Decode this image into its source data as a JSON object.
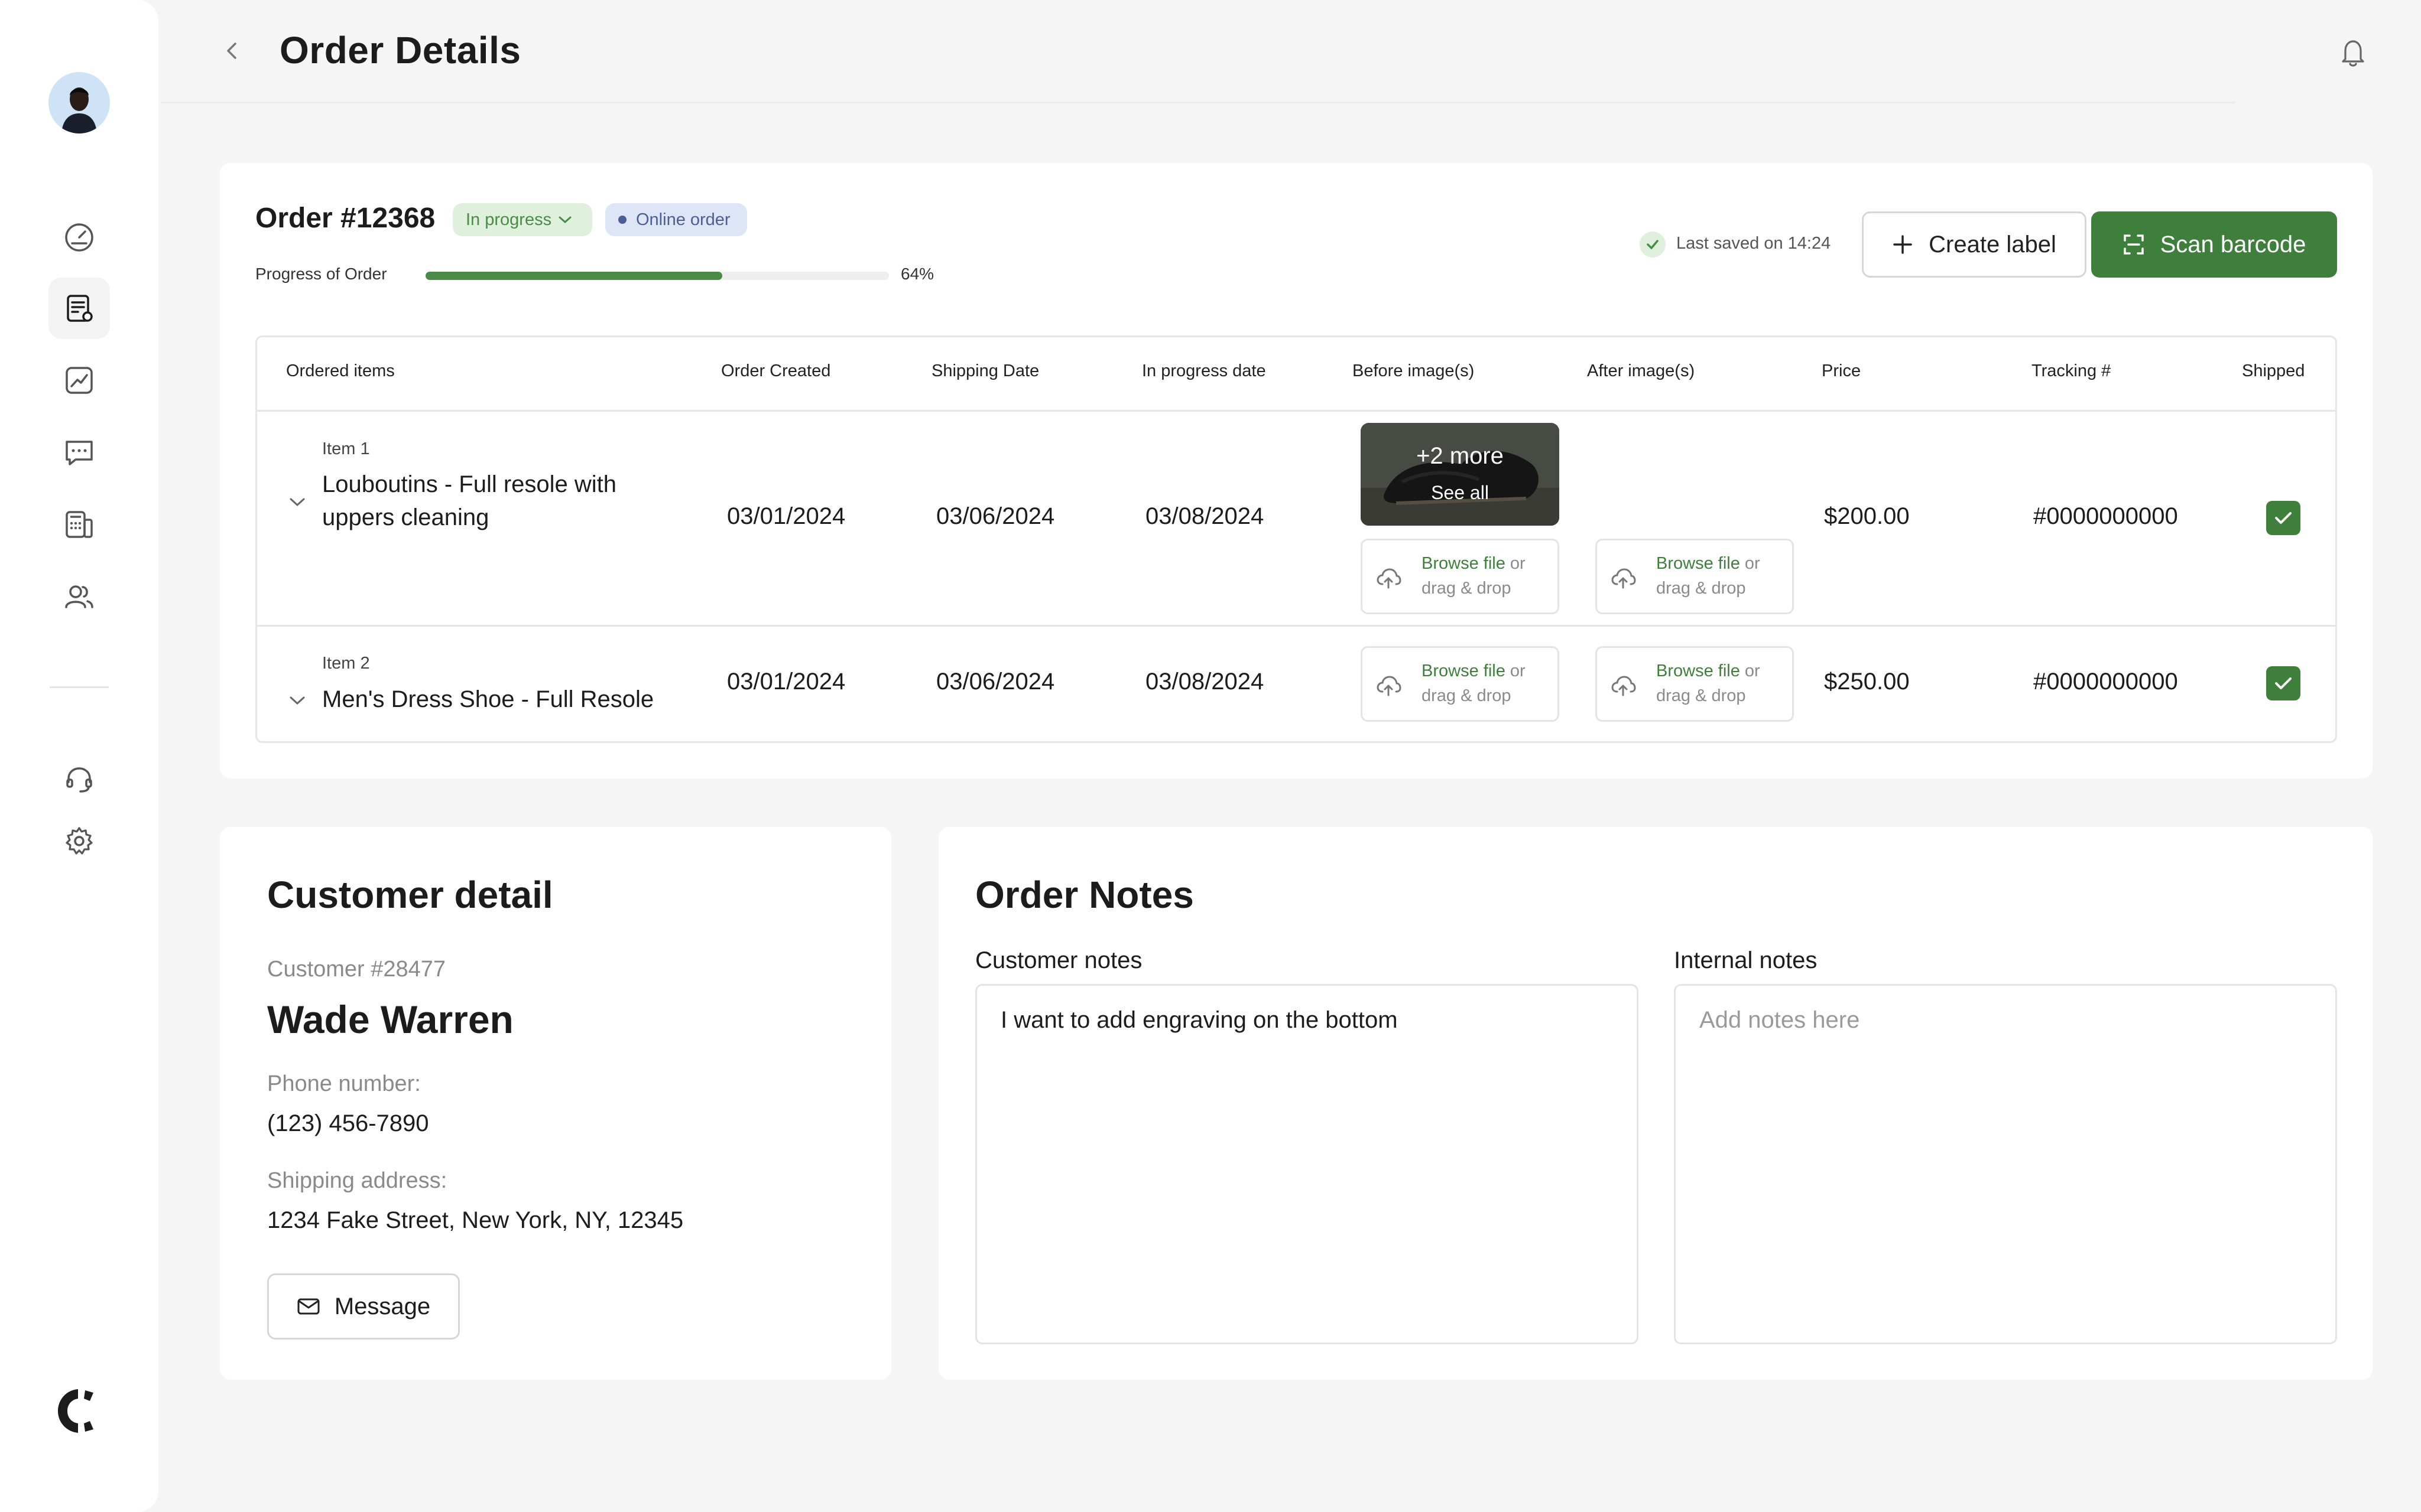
{
  "header": {
    "title": "Order Details"
  },
  "order": {
    "number": "Order #12368",
    "status": "In progress",
    "type": "Online order",
    "progress_label": "Progress of Order",
    "progress_value": 0.64,
    "progress_text": "64%",
    "last_saved": "Last saved on 14:24",
    "create_label": "Create label",
    "scan_barcode": "Scan barcode"
  },
  "table": {
    "columns": [
      "Ordered items",
      "Order Created",
      "Shipping Date",
      "In progress date",
      "Before image(s)",
      "After image(s)",
      "Price",
      "Tracking #",
      "Shipped"
    ],
    "upload_link": "Browse file",
    "upload_or": " or",
    "upload_drag": "drag & drop",
    "more_images": "+2 more",
    "see_all": "See all",
    "rows": [
      {
        "item_no": "Item 1",
        "name_line1": "Louboutins - Full resole with",
        "name_line2": "uppers cleaning",
        "created": "03/01/2024",
        "shipping": "03/06/2024",
        "in_progress": "03/08/2024",
        "price": "$200.00",
        "tracking": "#0000000000",
        "shipped": true
      },
      {
        "item_no": "Item 2",
        "name_line1": "Men's Dress Shoe - Full Resole",
        "created": "03/01/2024",
        "shipping": "03/06/2024",
        "in_progress": "03/08/2024",
        "price": "$250.00",
        "tracking": "#0000000000",
        "shipped": true
      }
    ]
  },
  "customer": {
    "title": "Customer detail",
    "number": "Customer #28477",
    "name": "Wade Warren",
    "phone_label": "Phone number:",
    "phone": "(123) 456-7890",
    "address_label": "Shipping address:",
    "address": "1234 Fake Street, New York, NY, 12345",
    "message_button": "Message"
  },
  "notes": {
    "title": "Order Notes",
    "customer_label": "Customer notes",
    "customer_value": "I want to add engraving on the bottom",
    "internal_label": "Internal notes",
    "internal_placeholder": "Add notes here"
  },
  "sidebar": {
    "icons": [
      "dashboard-icon",
      "orders-icon",
      "analytics-icon",
      "messages-icon",
      "calculator-icon",
      "customers-icon",
      "support-icon",
      "settings-icon"
    ]
  },
  "colors": {
    "accent": "#3f7f3c",
    "status_bg": "#dff0dc",
    "online_bg": "#dde5f7"
  }
}
